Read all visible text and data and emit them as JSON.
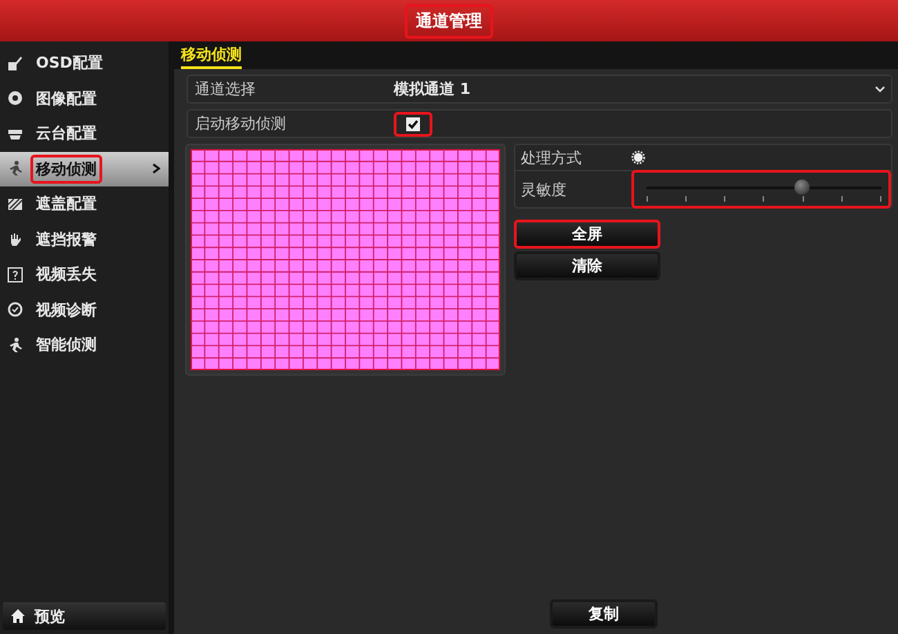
{
  "window": {
    "title": "通道管理",
    "highlighted": true
  },
  "sidebar": {
    "items": [
      {
        "label": "OSD配置",
        "selected": false,
        "highlighted": false
      },
      {
        "label": "图像配置",
        "selected": false,
        "highlighted": false
      },
      {
        "label": "云台配置",
        "selected": false,
        "highlighted": false
      },
      {
        "label": "移动侦测",
        "selected": true,
        "highlighted": true
      },
      {
        "label": "遮盖配置",
        "selected": false,
        "highlighted": false
      },
      {
        "label": "遮挡报警",
        "selected": false,
        "highlighted": false
      },
      {
        "label": "视频丢失",
        "selected": false,
        "highlighted": false
      },
      {
        "label": "视频诊断",
        "selected": false,
        "highlighted": false
      },
      {
        "label": "智能侦测",
        "selected": false,
        "highlighted": false
      }
    ],
    "bottom_button": "预览"
  },
  "section_tab": "移动侦测",
  "channel_select": {
    "label": "通道选择",
    "value": "模拟通道 1"
  },
  "enable_motion": {
    "label": "启动移动侦测",
    "checked": true,
    "highlighted": true
  },
  "handling": {
    "label": "处理方式"
  },
  "sensitivity": {
    "label": "灵敏度",
    "level": 0.66,
    "highlighted": true
  },
  "buttons": [
    {
      "label": "全屏",
      "highlighted": true
    },
    {
      "label": "清除",
      "highlighted": false
    }
  ],
  "copy_button": "复制"
}
